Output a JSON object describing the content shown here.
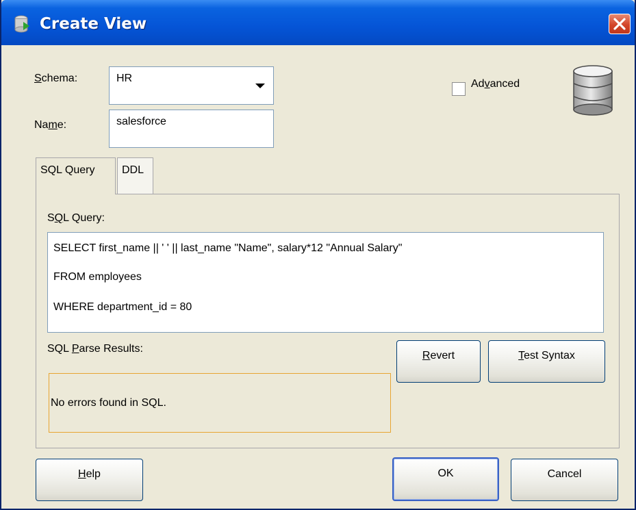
{
  "window": {
    "title": "Create View"
  },
  "form": {
    "schema_label": "Schema:",
    "schema_value": "HR",
    "name_label": "Name:",
    "name_value": "salesforce",
    "advanced_label": "Advanced",
    "advanced_checked": false
  },
  "tabs": [
    {
      "label": "SQL Query",
      "active": true
    },
    {
      "label": "DDL",
      "active": false
    }
  ],
  "sql_panel": {
    "query_label": "SQL Query:",
    "query_lines": [
      "SELECT first_name || ' ' || last_name \"Name\", salary*12 \"Annual Salary\"",
      "FROM employees",
      "WHERE department_id = 80"
    ],
    "parse_results_label": "SQL Parse Results:",
    "parse_results_text": "No errors found in SQL.",
    "revert_label": "Revert",
    "test_syntax_label": "Test Syntax"
  },
  "footer": {
    "help_label": "Help",
    "ok_label": "OK",
    "cancel_label": "Cancel"
  },
  "colors": {
    "titlebar": "#0554d6",
    "dialog_bg": "#ece9d8",
    "results_border": "#e8a531",
    "close_button": "#d3452a"
  }
}
